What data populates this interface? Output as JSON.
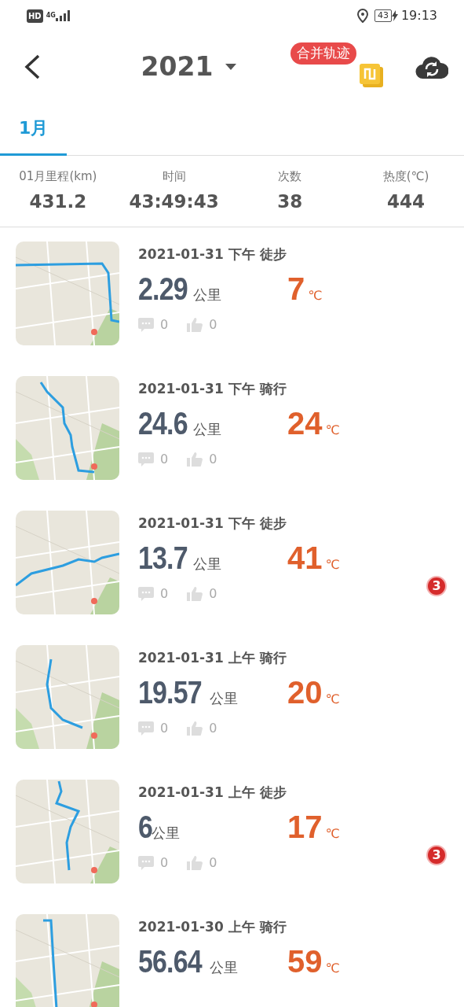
{
  "status_bar": {
    "hd": "HD",
    "network": "4G",
    "battery": "43",
    "time": "19:13"
  },
  "header": {
    "year": "2021",
    "merge_badge": "合并轨迹"
  },
  "tabs": [
    {
      "label": "1月",
      "selected": true
    }
  ],
  "summary": [
    {
      "label": "01月里程(km)",
      "value": "431.2"
    },
    {
      "label": "时间",
      "value": "43:49:43"
    },
    {
      "label": "次数",
      "value": "38"
    },
    {
      "label": "热度(℃)",
      "value": "444"
    }
  ],
  "activities": [
    {
      "title": "2021-01-31 下午 徒步",
      "distance": "2.29",
      "distance_unit": "公里",
      "heat": "7",
      "heat_unit": "℃",
      "comments": "0",
      "likes": "0"
    },
    {
      "title": "2021-01-31 下午 骑行",
      "distance": "24.6",
      "distance_unit": "公里",
      "heat": "24",
      "heat_unit": "℃",
      "comments": "0",
      "likes": "0"
    },
    {
      "title": "2021-01-31 下午 徒步",
      "distance": "13.7",
      "distance_unit": "公里",
      "heat": "41",
      "heat_unit": "℃",
      "comments": "0",
      "likes": "0",
      "badge": "3"
    },
    {
      "title": "2021-01-31 上午 骑行",
      "distance": "19.57",
      "distance_unit": "公里",
      "heat": "20",
      "heat_unit": "℃",
      "comments": "0",
      "likes": "0"
    },
    {
      "title": "2021-01-31 上午 徒步",
      "distance": "6",
      "distance_unit": "公里",
      "heat": "17",
      "heat_unit": "℃",
      "comments": "0",
      "likes": "0",
      "badge": "3"
    },
    {
      "title": "2021-01-30 上午 骑行",
      "distance": "56.64",
      "distance_unit": "公里",
      "heat": "59",
      "heat_unit": "℃"
    }
  ]
}
